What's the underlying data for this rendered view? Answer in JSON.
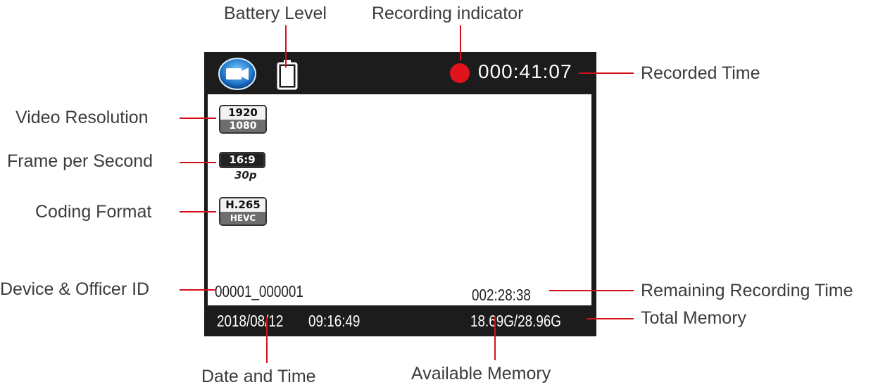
{
  "callouts": {
    "battery_level": "Battery Level",
    "recording_indicator": "Recording indicator",
    "recorded_time": "Recorded Time",
    "video_resolution": "Video Resolution",
    "frame_per_second": "Frame per Second",
    "coding_format": "Coding Format",
    "device_officer_id": "Device & Officer ID",
    "remaining_recording_time": "Remaining Recording Time",
    "total_memory": "Total Memory",
    "date_and_time": "Date and Time",
    "available_memory": "Available Memory"
  },
  "screen": {
    "recorded_time": "000:41:07",
    "resolution_top": "1920",
    "resolution_bottom": "1080",
    "aspect": "16:9",
    "fps": "30p",
    "codec_top": "H.265",
    "codec_bottom": "HEVC",
    "device_id": "00001_000001",
    "remaining_time": "002:28:38",
    "date": "2018/08/12",
    "time": "09:16:49",
    "memory": "18.69G/28.96G"
  },
  "colors": {
    "accent": "#d4101b",
    "screen_bg": "#1c1c1c",
    "record": "#e1141e"
  },
  "icons": [
    "video-camera-icon",
    "battery-icon",
    "record-dot-icon"
  ]
}
